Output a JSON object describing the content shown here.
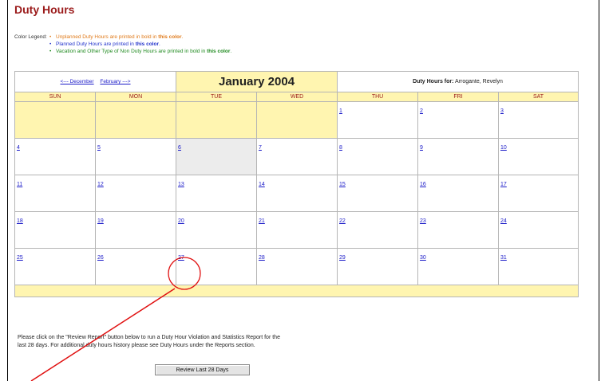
{
  "page": {
    "title": "Duty Hours"
  },
  "legend": {
    "label": "Color Legend:",
    "items": [
      {
        "bullet": "•",
        "prefix": "Unplanned Duty Hours are printed in bold in ",
        "emph": "this color",
        "suffix": ".",
        "color": "#e07a1a"
      },
      {
        "bullet": "•",
        "prefix": "Planned Duty Hours are printed in ",
        "emph": "this color",
        "suffix": ".",
        "color": "#2233cc"
      },
      {
        "bullet": "•",
        "prefix": "Vacation and Other Type of Non Duty Hours are printed in bold in ",
        "emph": "this color",
        "suffix": ".",
        "color": "#1f8a1f"
      }
    ]
  },
  "calendar": {
    "prev_link": "<--- December",
    "next_link": "February --->",
    "month_title": "January 2004",
    "owner_label": "Duty Hours for:",
    "owner_name": "Arrogante, Revelyn",
    "weekdays": [
      "SUN",
      "MON",
      "TUE",
      "WED",
      "THU",
      "FRI",
      "SAT"
    ],
    "weeks": [
      [
        "",
        "",
        "",
        "",
        "1",
        "2",
        "3"
      ],
      [
        "4",
        "5",
        "6",
        "7",
        "8",
        "9",
        "10"
      ],
      [
        "11",
        "12",
        "13",
        "14",
        "15",
        "16",
        "17"
      ],
      [
        "18",
        "19",
        "20",
        "21",
        "22",
        "23",
        "24"
      ],
      [
        "25",
        "26",
        "27",
        "28",
        "29",
        "30",
        "31"
      ]
    ],
    "highlighted_day": "6"
  },
  "report": {
    "note_line1": "Please click on the \"Review Report\" button below to run a Duty Hour Violation and Statistics Report for the",
    "note_line2": "last 28 days. For additional duty hours history please see Duty Hours under the Reports section.",
    "button_label": "Review Last 28 Days"
  },
  "annotation": {
    "color": "#e01010",
    "circled_day": "27"
  }
}
